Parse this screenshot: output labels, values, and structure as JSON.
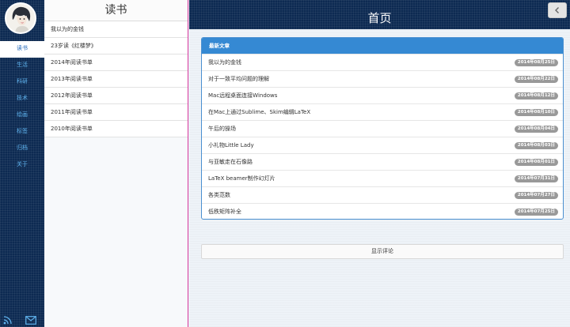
{
  "sidebar": {
    "items": [
      {
        "label": "读书",
        "active": true
      },
      {
        "label": "生活",
        "active": false
      },
      {
        "label": "科研",
        "active": false
      },
      {
        "label": "技术",
        "active": false
      },
      {
        "label": "绘画",
        "active": false
      },
      {
        "label": "标签",
        "active": false
      },
      {
        "label": "归档",
        "active": false
      },
      {
        "label": "关于",
        "active": false
      }
    ],
    "footer_icons": [
      "rss-icon",
      "mail-icon"
    ],
    "accent_color": "#5fb3ee"
  },
  "listcol": {
    "title": "读书",
    "items": [
      "我以为的金钱",
      "23岁读《红楼梦》",
      "2014年阅读书单",
      "2013年阅读书单",
      "2012年阅读书单",
      "2011年阅读书单",
      "2010年阅读书单"
    ],
    "divider_color": "#d6359c"
  },
  "main": {
    "title": "首页",
    "back_icon": "chevron-left-icon",
    "panel": {
      "heading": "最新文章",
      "heading_color": "#3589d3",
      "articles": [
        {
          "title": "我以为的金钱",
          "date": "2014年08月25日"
        },
        {
          "title": "对于一致平均问题的理解",
          "date": "2014年08月22日"
        },
        {
          "title": "Mac远程桌面连接Windows",
          "date": "2014年08月12日"
        },
        {
          "title": "在Mac上通过Sublime、Skim编辑LaTeX",
          "date": "2014年08月10日"
        },
        {
          "title": "午后的操场",
          "date": "2014年08月04日"
        },
        {
          "title": "小礼物Little Lady",
          "date": "2014年08月03日"
        },
        {
          "title": "与亚敏走在石像路",
          "date": "2014年08月01日"
        },
        {
          "title": "LaTeX beamer制作幻灯片",
          "date": "2014年07月31日"
        },
        {
          "title": "各类范数",
          "date": "2014年07月27日"
        },
        {
          "title": "低秩矩阵补全",
          "date": "2014年07月25日"
        }
      ]
    },
    "comments_button": "显示评论"
  }
}
